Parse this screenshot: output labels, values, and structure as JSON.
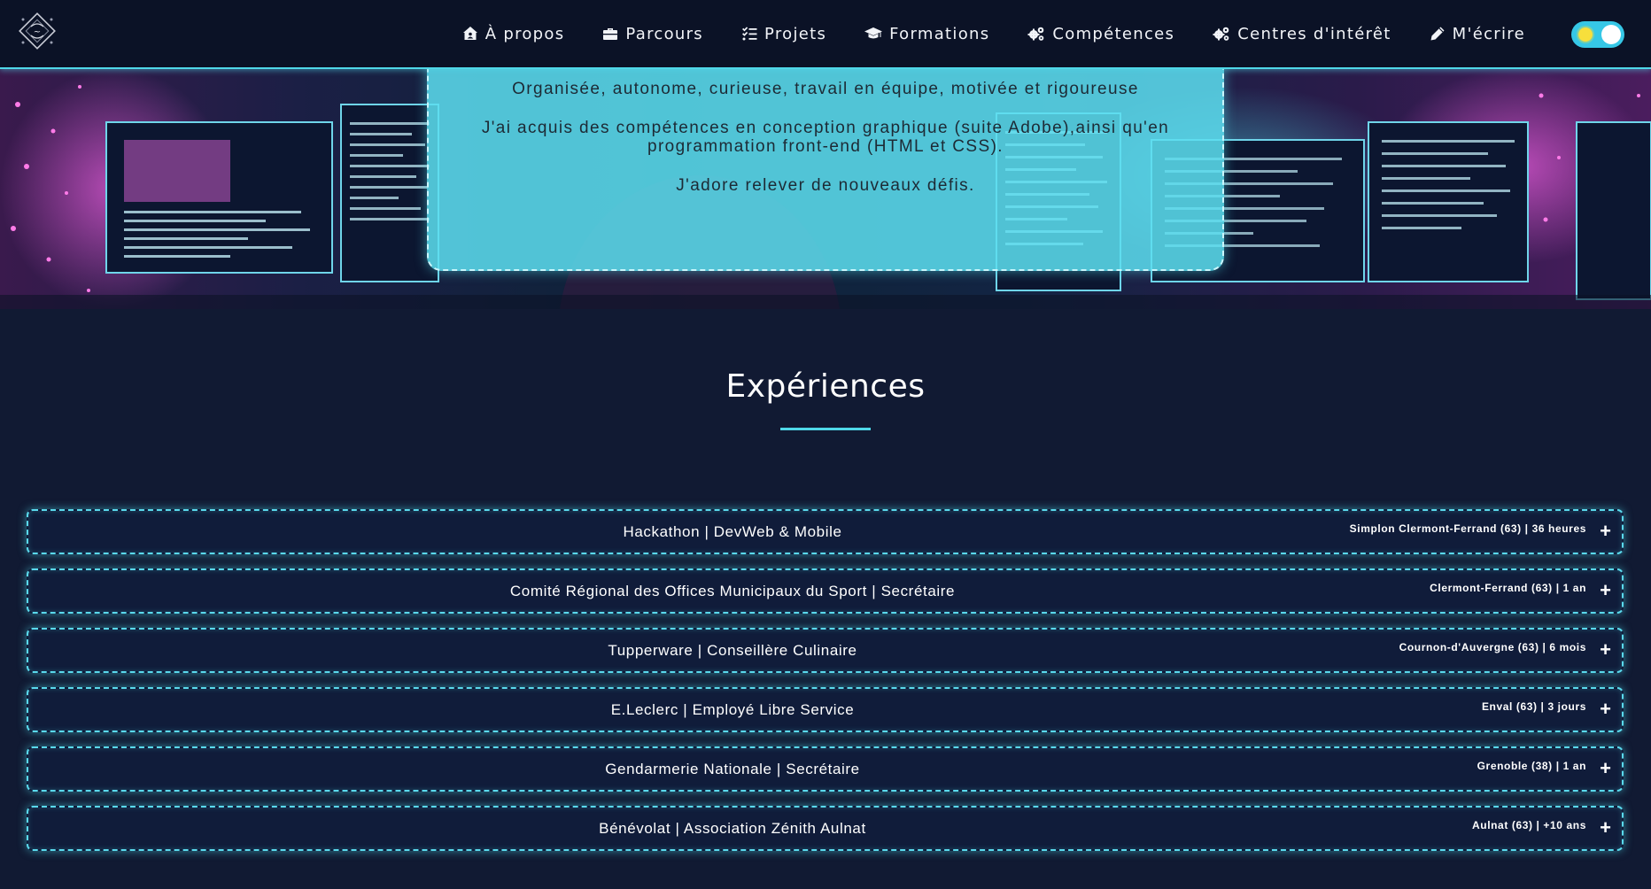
{
  "nav": {
    "items": [
      {
        "label": "À propos",
        "icon": "house-user-icon"
      },
      {
        "label": "Parcours",
        "icon": "briefcase-icon"
      },
      {
        "label": "Projets",
        "icon": "list-check-icon"
      },
      {
        "label": "Formations",
        "icon": "graduation-cap-icon"
      },
      {
        "label": "Compétences",
        "icon": "gears-icon"
      },
      {
        "label": "Centres d'intérêt",
        "icon": "gears-icon"
      },
      {
        "label": "M'écrire",
        "icon": "pencil-icon"
      }
    ],
    "theme_toggle": {
      "state": "light",
      "icon": "sun-icon"
    }
  },
  "about": {
    "lines": [
      "Organisée, autonome, curieuse, travail en équipe, motivée et rigoureuse",
      "J'ai acquis des compétences en conception graphique (suite Adobe),ainsi qu'en programmation front-end (HTML et CSS).",
      "J'adore relever de nouveaux défis."
    ]
  },
  "experiences": {
    "title": "Expériences",
    "items": [
      {
        "title": "Hackathon | DevWeb & Mobile",
        "meta": "Simplon Clermont-Ferrand (63) | 36 heures",
        "toggle": "+"
      },
      {
        "title": "Comité Régional des Offices Municipaux du Sport | Secrétaire",
        "meta": "Clermont-Ferrand (63) | 1 an",
        "toggle": "+"
      },
      {
        "title": "Tupperware | Conseillère Culinaire",
        "meta": "Cournon-d'Auvergne (63) | 6 mois",
        "toggle": "+"
      },
      {
        "title": "E.Leclerc | Employé Libre Service",
        "meta": "Enval (63) | 3 jours",
        "toggle": "+"
      },
      {
        "title": "Gendarmerie Nationale | Secrétaire",
        "meta": "Grenoble (38) | 1 an",
        "toggle": "+"
      },
      {
        "title": "Bénévolat | Association Zénith Aulnat",
        "meta": "Aulnat (63) | +10 ans",
        "toggle": "+"
      }
    ]
  },
  "colors": {
    "accent": "#4fd8e8",
    "background": "#111a33",
    "navbar": "#0b1226",
    "toggle": "#36c7e6"
  }
}
